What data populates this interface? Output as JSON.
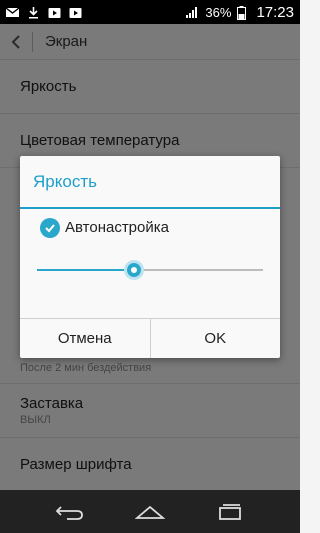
{
  "status_bar": {
    "battery": "36%",
    "time": "17:23",
    "icons": [
      "gmail-icon",
      "download-icon",
      "play-store-icon",
      "play-store-icon",
      "signal-icon",
      "battery-icon"
    ]
  },
  "action_bar": {
    "title": "Экран",
    "back_icon": "back-arrow-icon"
  },
  "settings": {
    "items": [
      {
        "title": "Яркость"
      },
      {
        "title": "Цветовая температура"
      },
      {
        "subtitle": "После 2 мин бездействия"
      },
      {
        "title": "Заставка",
        "subtitle": "ВЫКЛ"
      },
      {
        "title": "Размер шрифта"
      }
    ]
  },
  "dialog": {
    "title": "Яркость",
    "auto_label": "Автонастройка",
    "auto_checked": true,
    "slider_value": 0.43,
    "cancel_label": "Отмена",
    "ok_label": "OK"
  },
  "colors": {
    "accent": "#1e9fc9",
    "overlay": "#000000"
  },
  "nav_bar": {
    "icons": [
      "back-icon",
      "home-icon",
      "recents-icon"
    ]
  }
}
